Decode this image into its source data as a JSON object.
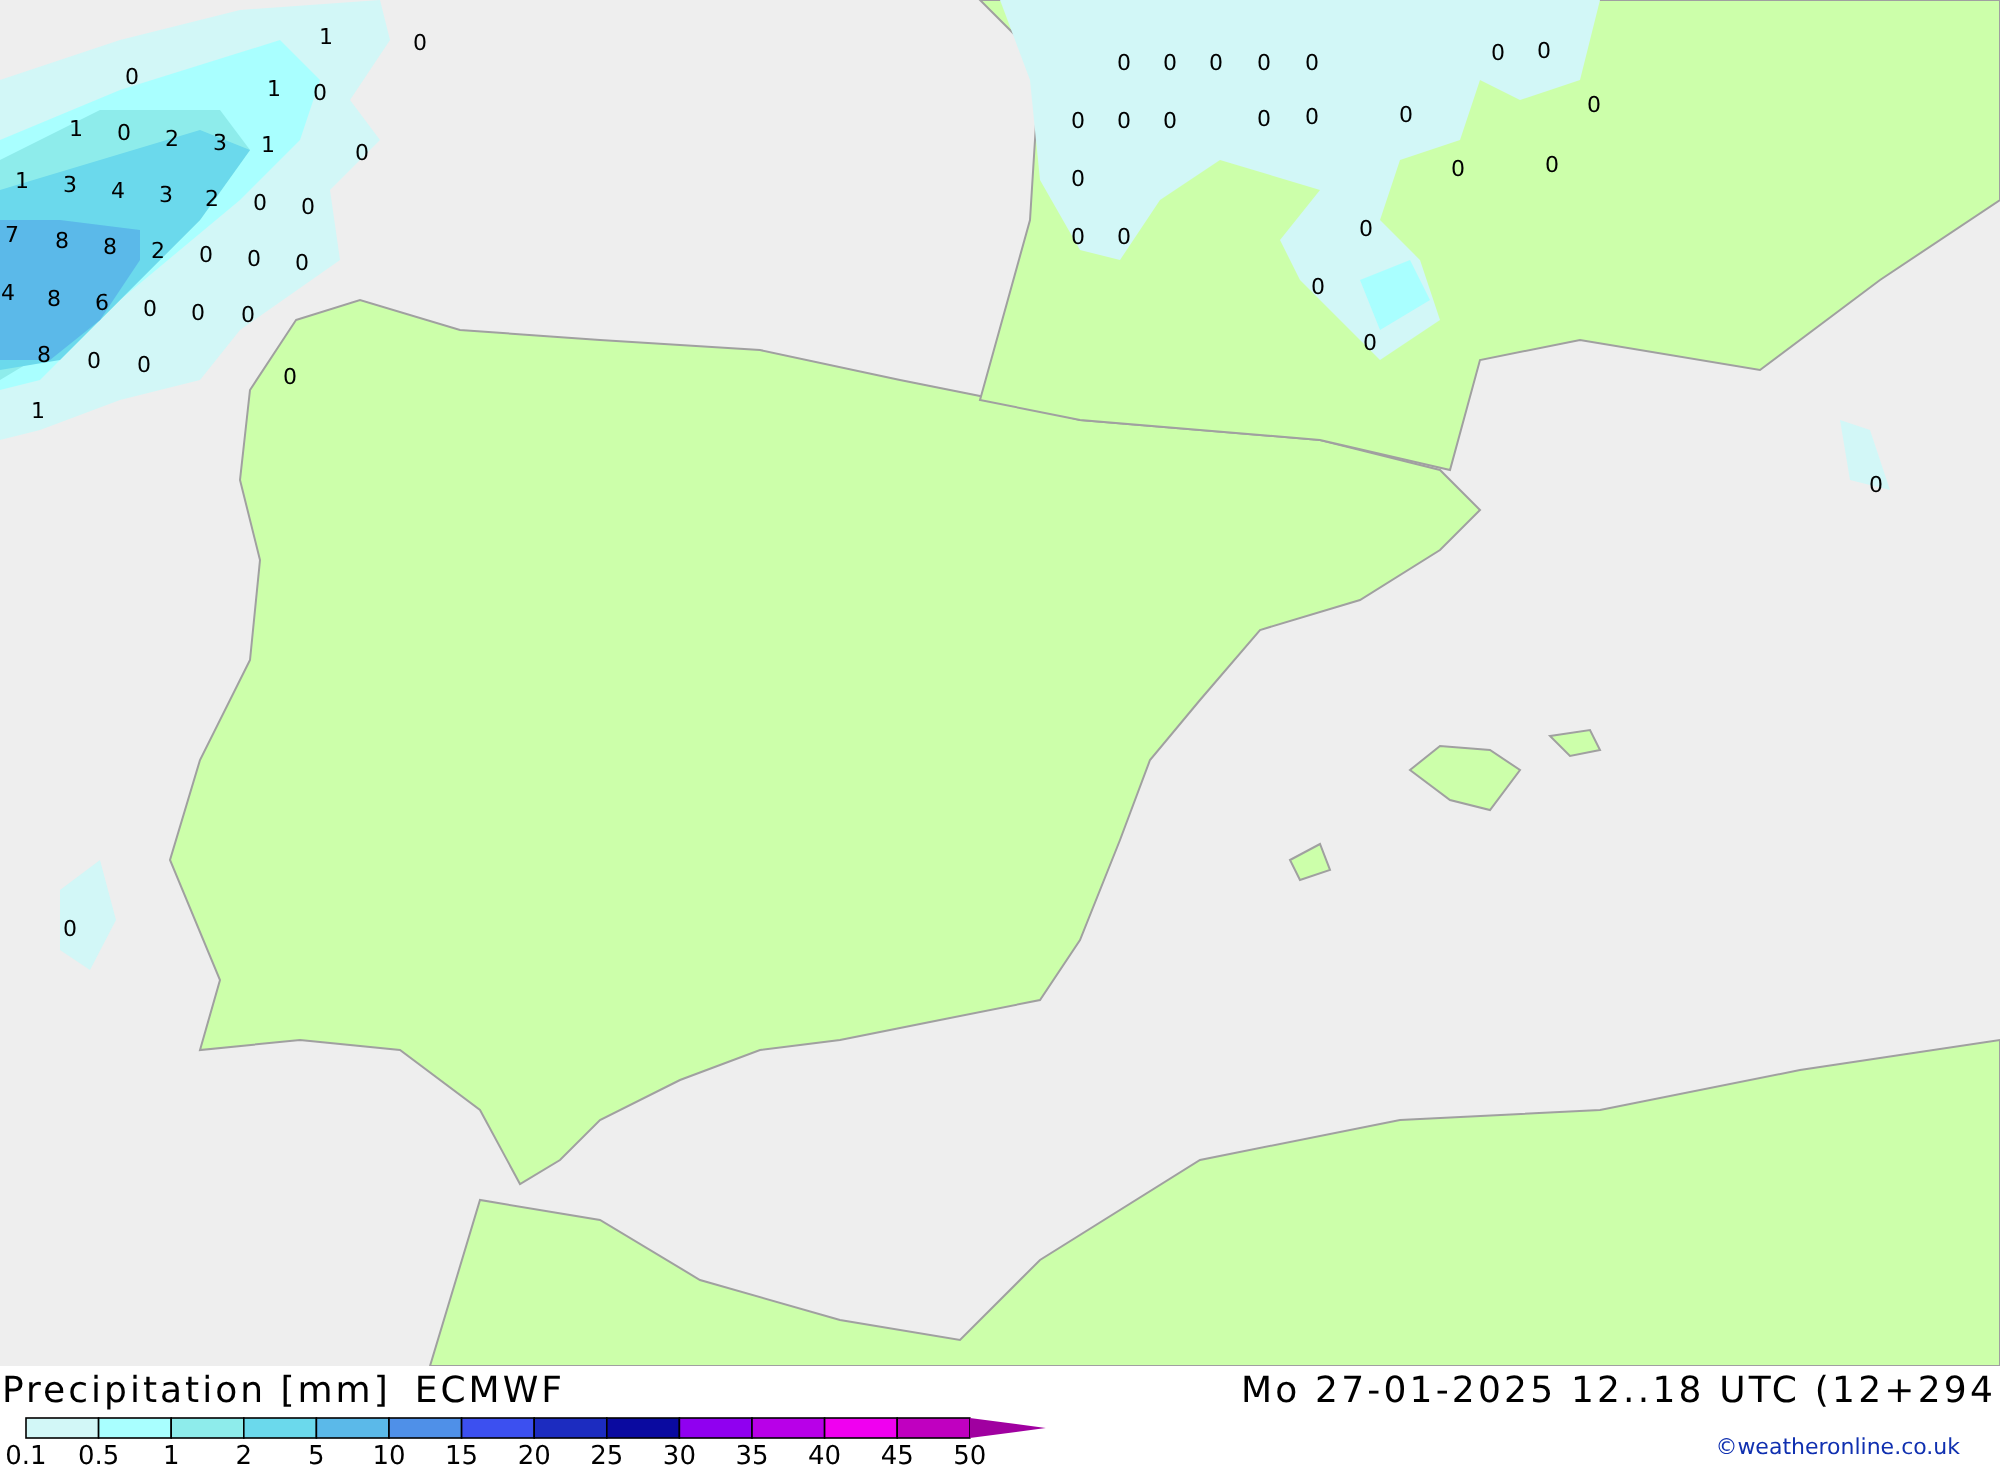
{
  "map": {
    "precipitation_values": [
      "1",
      "0",
      "0",
      "1",
      "0",
      "1",
      "0",
      "2",
      "3",
      "1",
      "0",
      "1",
      "3",
      "4",
      "3",
      "2",
      "0",
      "0",
      "7",
      "8",
      "8",
      "2",
      "0",
      "0",
      "0",
      "4",
      "8",
      "6",
      "0",
      "0",
      "0",
      "8",
      "0",
      "0",
      "1",
      "0",
      "0",
      "0",
      "0",
      "0",
      "0",
      "0",
      "0",
      "0",
      "0",
      "0",
      "0",
      "0",
      "0",
      "0",
      "0",
      "0",
      "0",
      "0",
      "0",
      "0",
      "0",
      "0",
      "0",
      "0"
    ]
  },
  "footer": {
    "title": "Precipitation [mm]",
    "model": "ECMWF",
    "datetime": "Mo 27-01-2025 12..18 UTC (12+294",
    "credit": "©weatheronline.co.uk"
  },
  "legend": {
    "bins": [
      {
        "color": "#d2f7f7"
      },
      {
        "color": "#a9ffff"
      },
      {
        "color": "#8eeceb"
      },
      {
        "color": "#6bd9ec"
      },
      {
        "color": "#5bb9e9"
      },
      {
        "color": "#4f90e8"
      },
      {
        "color": "#3c50f0"
      },
      {
        "color": "#1c2cc0"
      },
      {
        "color": "#0a0aa0"
      },
      {
        "color": "#9000f0"
      },
      {
        "color": "#b800e8"
      },
      {
        "color": "#f000f0"
      },
      {
        "color": "#c000c0"
      },
      {
        "color": "#a000a0",
        "kind": "arrow"
      }
    ],
    "labels": [
      "0.1",
      "0.5",
      "1",
      "2",
      "5",
      "10",
      "15",
      "20",
      "25",
      "30",
      "35",
      "40",
      "45",
      "50"
    ]
  }
}
